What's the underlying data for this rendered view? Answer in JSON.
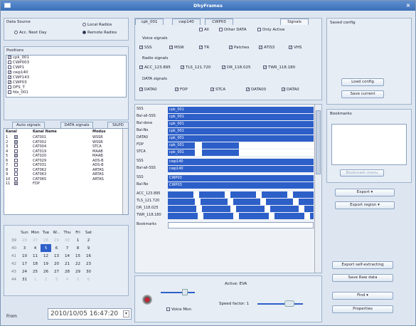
{
  "window": {
    "title": "DhyFrames"
  },
  "data_source": {
    "label": "Data Source",
    "local_radio": "Local Radios",
    "acc_next_day": "Acc. Next Day",
    "remote_radio": "Remote Radios",
    "local_selected": false,
    "remote_selected": true
  },
  "positions": {
    "label": "Positions",
    "items": [
      "cpk_001",
      "CWP003",
      "CWP1",
      "cwp140",
      "CWP143",
      "CWP03",
      "DFS_T",
      "fdx_001"
    ],
    "checked": [
      true,
      false,
      false,
      true,
      true,
      true,
      false,
      false
    ]
  },
  "tabs_left": {
    "a": "Auto signals",
    "b": "DATA signals",
    "c": "SILPD"
  },
  "kanal_table": {
    "headers": [
      "Kanal",
      "",
      "Kanal Name",
      "Modus"
    ],
    "rows": [
      [
        "1",
        "x",
        "CAT001",
        "WSSR"
      ],
      [
        "2",
        "x",
        "CAT002",
        "WSSR"
      ],
      [
        "3",
        "",
        "CAT004",
        "STCA"
      ],
      [
        "4",
        "",
        "CAT019",
        "MAAB"
      ],
      [
        "5",
        "x",
        "CAT020",
        "MAAB"
      ],
      [
        "6",
        "",
        "CAT029",
        "ADS-B"
      ],
      [
        "7",
        "",
        "CAT031",
        "ADS-B"
      ],
      [
        "8",
        "",
        "CAT062",
        "ARTAS"
      ],
      [
        "9",
        "",
        "CAT063",
        "ARTAS"
      ],
      [
        "10",
        "",
        "CAT065",
        "ARTAS"
      ],
      [
        "11",
        "x",
        "FDP",
        ""
      ]
    ]
  },
  "calendar": {
    "weekdays": [
      "",
      "Sun",
      "Mon",
      "Tue",
      "W...",
      "Thu",
      "Fri",
      "Sat"
    ],
    "weeks": [
      [
        "39",
        "26",
        "27",
        "28",
        "29",
        "30",
        "1",
        "2"
      ],
      [
        "40",
        "3",
        "4",
        "5",
        "6",
        "7",
        "8",
        "9"
      ],
      [
        "41",
        "10",
        "11",
        "12",
        "13",
        "14",
        "15",
        "16"
      ],
      [
        "42",
        "17",
        "18",
        "19",
        "20",
        "21",
        "22",
        "23"
      ],
      [
        "43",
        "24",
        "25",
        "26",
        "27",
        "28",
        "29",
        "30"
      ],
      [
        "44",
        "31",
        "1",
        "2",
        "3",
        "4",
        "5",
        "6"
      ]
    ],
    "selected_day": "5"
  },
  "from": {
    "label": "From",
    "value": "2010/10/05 16:47:20"
  },
  "signal_tabs": [
    "cpk_001",
    "cwp140",
    "CWP03",
    "Signals"
  ],
  "signal_filters": {
    "all": "All",
    "other_data": "Other DATA",
    "only_active": "Only Active",
    "voice_label": "Voice signals",
    "voice": [
      "SSS",
      "MSW",
      "TR",
      "Patches",
      "ATIS3",
      "VHS"
    ],
    "radio_label": "Radio signals",
    "radio": [
      "ACC_123.895",
      "TLS_121.720",
      "DR_118.025",
      "TWR_118.180"
    ],
    "data_label": "DATA signals",
    "data": [
      "DATA0",
      "FDP",
      "STCA",
      "DATA00",
      "DATA0"
    ]
  },
  "timeline": {
    "rows": [
      {
        "name": "SSS",
        "label": "cpk_001"
      },
      {
        "name": "Bal-all-SSS",
        "label": "cpk_001"
      },
      {
        "name": "Bal-done",
        "label": "cpk_001"
      },
      {
        "name": "Bal-No",
        "label": "cpk_001"
      },
      {
        "name": "DATA0",
        "label": "cpk_001"
      },
      {
        "name": "FDP",
        "label": "cpk_001"
      },
      {
        "name": "STCA",
        "label": "cpk_001"
      },
      {
        "name": "SSS",
        "label": "cwp140"
      },
      {
        "name": "Bal-all-SSS",
        "label": "cwp140"
      },
      {
        "name": "SSS",
        "label": "CWP03"
      },
      {
        "name": "Bal-No",
        "label": "CWP03"
      },
      {
        "name": "ACC_123.895",
        "label": ""
      },
      {
        "name": "TLS_121.720",
        "label": ""
      },
      {
        "name": "DR_118.025",
        "label": ""
      },
      {
        "name": "TWR_118.180",
        "label": ""
      },
      {
        "name": "Bookmarks",
        "label": ""
      }
    ]
  },
  "playback": {
    "active": "Active: EVA",
    "voice": "Voice Mon",
    "speed": "Speed factor: 1"
  },
  "right": {
    "saved_config": "Saved config",
    "load_config": "Load config",
    "save_current": "Save current",
    "bookmarks": "Bookmarks",
    "bookmark_menu": "Bookmark menu",
    "export": "Export",
    "export_region": "Export region",
    "export_extracting": "Export self-extracting",
    "save_raw": "Save Raw data",
    "find": "Find",
    "properties": "Properties"
  },
  "colors": {
    "accent": "#2d5fc8",
    "title": "#3a6fb8"
  }
}
